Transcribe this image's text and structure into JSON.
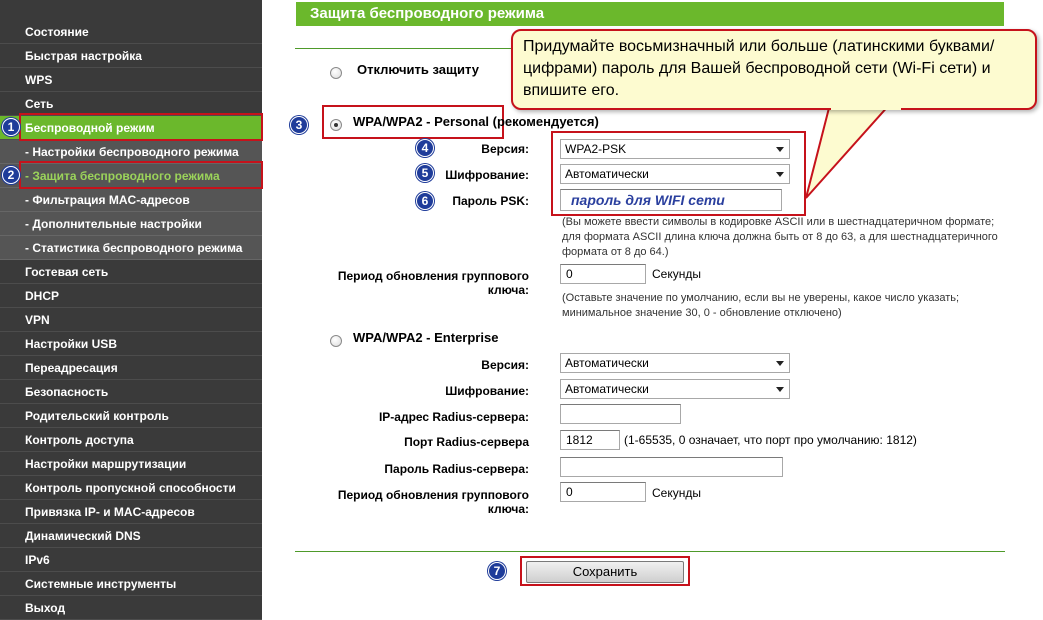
{
  "sidebar": {
    "items": [
      {
        "label": "Состояние"
      },
      {
        "label": "Быстрая настройка"
      },
      {
        "label": "WPS"
      },
      {
        "label": "Сеть"
      },
      {
        "label": "Беспроводной режим"
      },
      {
        "label": "- Настройки беспроводного режима"
      },
      {
        "label": "- Защита беспроводного режима"
      },
      {
        "label": "- Фильтрация MAC-адресов"
      },
      {
        "label": "- Дополнительные настройки"
      },
      {
        "label": "- Статистика беспроводного режима"
      },
      {
        "label": "Гостевая сеть"
      },
      {
        "label": "DHCP"
      },
      {
        "label": "VPN"
      },
      {
        "label": "Настройки USB"
      },
      {
        "label": "Переадресация"
      },
      {
        "label": "Безопасность"
      },
      {
        "label": "Родительский контроль"
      },
      {
        "label": "Контроль доступа"
      },
      {
        "label": "Настройки маршрутизации"
      },
      {
        "label": "Контроль пропускной способности"
      },
      {
        "label": "Привязка IP- и MAC-адресов"
      },
      {
        "label": "Динамический DNS"
      },
      {
        "label": "IPv6"
      },
      {
        "label": "Системные инструменты"
      },
      {
        "label": "Выход"
      }
    ]
  },
  "markers": [
    "1",
    "2",
    "3",
    "4",
    "5",
    "6",
    "7"
  ],
  "page_title": "Защита беспроводного режима",
  "callout": "Придумайте восьмизначный или больше (латинскими буквами/цифрами) пароль для Вашей беспроводной сети (Wi-Fi сети) и впишите его.",
  "disable": {
    "label": "Отключить защиту"
  },
  "personal": {
    "title": "WPA/WPA2 - Personal (рекомендуется)",
    "version_label": "Версия:",
    "version_value": "WPA2-PSK",
    "encryption_label": "Шифрование:",
    "encryption_value": "Автоматически",
    "psk_label": "Пароль PSK:",
    "psk_value": "пароль для WIFI сети",
    "psk_hint": "(Вы можете ввести символы в кодировке ASCII или в шестнадцатеричном формате; для формата ASCII длина ключа должна быть от 8 до 63, а для шестнадцатеричного формата от 8 до 64.)",
    "group_key_label": "Период обновления группового ключа:",
    "group_key_value": "0",
    "group_key_unit": "Секунды",
    "group_key_hint": "(Оставьте значение по умолчанию, если вы не уверены, какое число указать; минимальное значение 30, 0 - обновление отключено)"
  },
  "enterprise": {
    "title": "WPA/WPA2 - Enterprise",
    "version_label": "Версия:",
    "version_value": "Автоматически",
    "encryption_label": "Шифрование:",
    "encryption_value": "Автоматически",
    "radius_ip_label": "IP-адрес Radius-сервера:",
    "radius_ip_value": "",
    "radius_port_label": "Порт Radius-сервера",
    "radius_port_value": "1812",
    "radius_port_hint": "(1-65535, 0 означает, что порт про умолчанию: 1812)",
    "radius_password_label": "Пароль Radius-сервера:",
    "radius_password_value": "",
    "group_key_label": "Период обновления группового ключа:",
    "group_key_value": "0",
    "group_key_unit": "Секунды"
  },
  "save_label": "Сохранить",
  "colors": {
    "accent_green": "#6bb82c",
    "annotation_red": "#c6121b",
    "marker_blue": "#1f3c9a",
    "callout_bg": "#fdfbd0"
  }
}
